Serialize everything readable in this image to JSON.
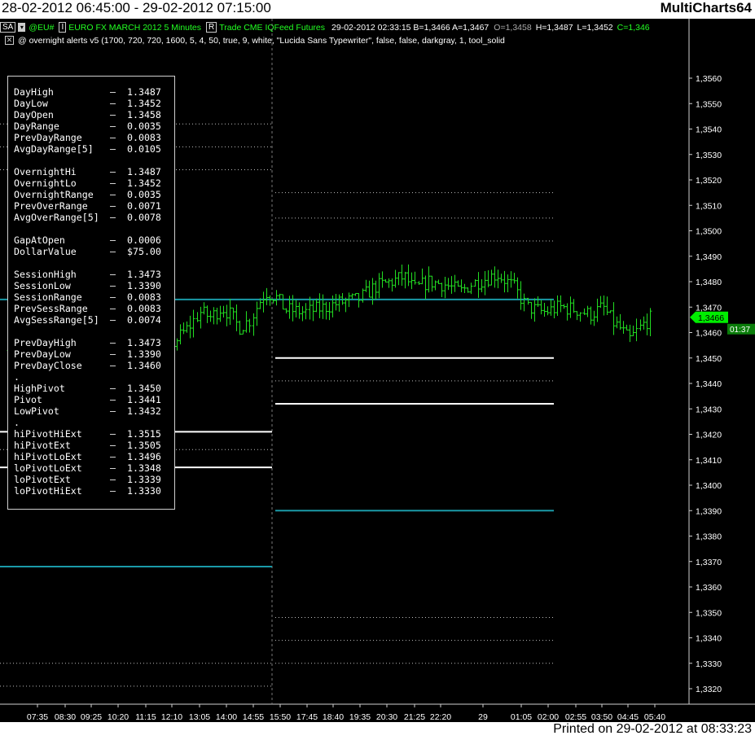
{
  "window": {
    "title": "28-02-2012 06:45:00 - 29-02-2012 07:15:00",
    "brand": "MultiCharts64",
    "printed": "Printed on 29-02-2012 at 08:33:23"
  },
  "header": {
    "sa_label": "SA",
    "symbol": "@EU#",
    "interval_btn": "I",
    "instrument": "EURO FX MARCH 2012  5 Minutes",
    "r_btn": "R",
    "trade": "Trade  CME  IQFeed  Futures",
    "quote": "29-02-2012  02:33:15  B=1,3466  A=1,3467",
    "ohlc_o": "O=1,3458",
    "ohlc_h": "H=1,3487",
    "ohlc_l": "L=1,3452",
    "ohlc_c": "C=1,346",
    "study": "@ overnight alerts v5  (1700,  720,  720,  1600,  5,  4,  50,  true,  9,  white,  \"Lucida Sans Typewriter\",  false,  false,  darkgray,  1,  tool_solid"
  },
  "stats": [
    {
      "label": "DayHigh",
      "value": "1.3487"
    },
    {
      "label": "DayLow",
      "value": "1.3452"
    },
    {
      "label": "DayOpen",
      "value": "1.3458"
    },
    {
      "label": "DayRange",
      "value": "0.0035"
    },
    {
      "label": "PrevDayRange",
      "value": "0.0083"
    },
    {
      "label": "AvgDayRange[5]",
      "value": "0.0105"
    },
    {
      "label": "",
      "value": ""
    },
    {
      "label": "OvernightHi",
      "value": "1.3487"
    },
    {
      "label": "OvernightLo",
      "value": "1.3452"
    },
    {
      "label": "OvernightRange",
      "value": "0.0035"
    },
    {
      "label": "PrevOverRange",
      "value": "0.0071"
    },
    {
      "label": "AvgOverRange[5]",
      "value": "0.0078"
    },
    {
      "label": "",
      "value": ""
    },
    {
      "label": "GapAtOpen",
      "value": "0.0006"
    },
    {
      "label": "DollarValue",
      "value": "$75.00"
    },
    {
      "label": "",
      "value": ""
    },
    {
      "label": "SessionHigh",
      "value": "1.3473"
    },
    {
      "label": "SessionLow",
      "value": "1.3390"
    },
    {
      "label": "SessionRange",
      "value": "0.0083"
    },
    {
      "label": "PrevSessRange",
      "value": "0.0083"
    },
    {
      "label": "AvgSessRange[5]",
      "value": "0.0074"
    },
    {
      "label": "",
      "value": ""
    },
    {
      "label": "PrevDayHigh",
      "value": "1.3473"
    },
    {
      "label": "PrevDayLow",
      "value": "1.3390"
    },
    {
      "label": "PrevDayClose",
      "value": "1.3460"
    },
    {
      "label": ".",
      "value": ""
    },
    {
      "label": "HighPivot",
      "value": "1.3450"
    },
    {
      "label": "Pivot",
      "value": "1.3441"
    },
    {
      "label": "LowPivot",
      "value": "1.3432"
    },
    {
      "label": ".",
      "value": ""
    },
    {
      "label": "hiPivotHiExt",
      "value": "1.3515"
    },
    {
      "label": "hiPivotExt",
      "value": "1.3505"
    },
    {
      "label": "hiPivotLoExt",
      "value": "1.3496"
    },
    {
      "label": "loPivotLoExt",
      "value": "1.3348"
    },
    {
      "label": "loPivotExt",
      "value": "1.3339"
    },
    {
      "label": "loPivotHiExt",
      "value": "1.3330"
    }
  ],
  "colors": {
    "background": "#000000",
    "bars": "#22dd22",
    "session_lines": "#1a9aa8",
    "pivot_lines": "#ffffff",
    "dotted_lines": "#bdbdbd",
    "price_marker": "#00ee00"
  },
  "chart_data": {
    "type": "ohlc",
    "ylim": [
      1.3314,
      1.3568
    ],
    "y_ticks": [
      "1,3560",
      "1,3550",
      "1,3540",
      "1,3530",
      "1,3520",
      "1,3510",
      "1,3500",
      "1,3490",
      "1,3480",
      "1,3470",
      "1,3460",
      "1,3450",
      "1,3440",
      "1,3430",
      "1,3420",
      "1,3410",
      "1,3400",
      "1,3390",
      "1,3380",
      "1,3370",
      "1,3360",
      "1,3350",
      "1,3340",
      "1,3330",
      "1,3320"
    ],
    "x_ticks": [
      "07:35",
      "08:30",
      "09:25",
      "10:20",
      "11:15",
      "12:10",
      "13:05",
      "14:00",
      "14:55",
      "15:50",
      "17:45",
      "18:40",
      "19:35",
      "20:30",
      "21:25",
      "22:20",
      "29",
      "01:05",
      "02:00",
      "02:55",
      "03:50",
      "04:45",
      "05:40"
    ],
    "last_price": "1,3466",
    "countdown": "01:37",
    "close_path": [
      [
        "07:00",
        1.3453
      ],
      [
        "09:20",
        1.3447
      ],
      [
        "10:45",
        1.345
      ],
      [
        "11:25",
        1.3444
      ],
      [
        "11:55",
        1.3452
      ],
      [
        "12:35",
        1.3446
      ],
      [
        "13:10",
        1.3455
      ],
      [
        "13:50",
        1.3462
      ],
      [
        "14:15",
        1.3468
      ],
      [
        "14:40",
        1.3466
      ],
      [
        "15:05",
        1.347
      ],
      [
        "15:25",
        1.3467
      ],
      [
        "15:45",
        1.3462
      ],
      [
        "16:10",
        1.3465
      ],
      [
        "16:30",
        1.3472
      ],
      [
        "16:45",
        1.3476
      ],
      [
        "17:05",
        1.3474
      ],
      [
        "17:20",
        1.3469
      ],
      [
        "17:50",
        1.3468
      ],
      [
        "18:20",
        1.347
      ],
      [
        "18:45",
        1.3472
      ],
      [
        "19:10",
        1.3473
      ],
      [
        "19:35",
        1.3478
      ],
      [
        "20:00",
        1.348
      ],
      [
        "20:20",
        1.3482
      ],
      [
        "20:35",
        1.3477
      ],
      [
        "20:55",
        1.348
      ],
      [
        "21:20",
        1.3479
      ],
      [
        "21:45",
        1.3476
      ],
      [
        "22:00",
        1.3479
      ],
      [
        "22:20",
        1.3481
      ],
      [
        "22:40",
        1.3483
      ],
      [
        "23:05",
        1.3478
      ],
      [
        "23:25",
        1.347
      ],
      [
        "23:50",
        1.3468
      ],
      [
        "00:15",
        1.347
      ],
      [
        "00:40",
        1.3469
      ],
      [
        "01:00",
        1.3467
      ],
      [
        "01:20",
        1.347
      ],
      [
        "01:35",
        1.3464
      ],
      [
        "01:45",
        1.3462
      ],
      [
        "02:00",
        1.3457
      ],
      [
        "02:10",
        1.346
      ],
      [
        "02:20",
        1.3463
      ],
      [
        "02:33",
        1.3466
      ]
    ],
    "levels": [
      {
        "name": "SessionHigh",
        "value": 1.3473,
        "style": "solid",
        "color": "teal",
        "period": "all"
      },
      {
        "name": "SessionLow",
        "value": 1.339,
        "style": "solid",
        "color": "teal",
        "period": "current"
      },
      {
        "name": "PrevSessionLow",
        "value": 1.3368,
        "style": "solid",
        "color": "teal",
        "period": "prev"
      },
      {
        "name": "HighPivot",
        "value": 1.345,
        "style": "solid",
        "color": "white",
        "period": "current"
      },
      {
        "name": "LowPivot",
        "value": 1.3432,
        "style": "solid",
        "color": "white",
        "period": "current"
      },
      {
        "name": "PrevHighPivot",
        "value": 1.3421,
        "style": "solid",
        "color": "white",
        "period": "prev"
      },
      {
        "name": "PrevLowPivot",
        "value": 1.3407,
        "style": "solid",
        "color": "white",
        "period": "prev"
      },
      {
        "name": "PrevPivot",
        "value": 1.3414,
        "style": "dotted",
        "color": "gray",
        "period": "prev"
      },
      {
        "name": "Pivot",
        "value": 1.3441,
        "style": "dotted",
        "color": "gray",
        "period": "current"
      },
      {
        "name": "hiPivotHiExt",
        "value": 1.3515,
        "style": "dotted",
        "color": "gray",
        "period": "current"
      },
      {
        "name": "hiPivotExt",
        "value": 1.3505,
        "style": "dotted",
        "color": "gray",
        "period": "current"
      },
      {
        "name": "hiPivotLoExt",
        "value": 1.3496,
        "style": "dotted",
        "color": "gray",
        "period": "current"
      },
      {
        "name": "loPivotLoExt",
        "value": 1.3348,
        "style": "dotted",
        "color": "gray",
        "period": "current"
      },
      {
        "name": "loPivotExt",
        "value": 1.3339,
        "style": "dotted",
        "color": "gray",
        "period": "current"
      },
      {
        "name": "loPivotHiExt",
        "value": 1.333,
        "style": "dotted",
        "color": "gray",
        "period": "current"
      },
      {
        "name": "PrevHiExt1",
        "value": 1.3542,
        "style": "dotted",
        "color": "gray",
        "period": "prev"
      },
      {
        "name": "PrevHiExt2",
        "value": 1.3533,
        "style": "dotted",
        "color": "gray",
        "period": "prev"
      },
      {
        "name": "PrevHiExt3",
        "value": 1.3524,
        "style": "dotted",
        "color": "gray",
        "period": "prev"
      },
      {
        "name": "PrevLoExt1",
        "value": 1.333,
        "style": "dotted",
        "color": "gray",
        "period": "prev"
      },
      {
        "name": "PrevLoExt2",
        "value": 1.3321,
        "style": "dotted",
        "color": "gray",
        "period": "prev"
      }
    ]
  }
}
